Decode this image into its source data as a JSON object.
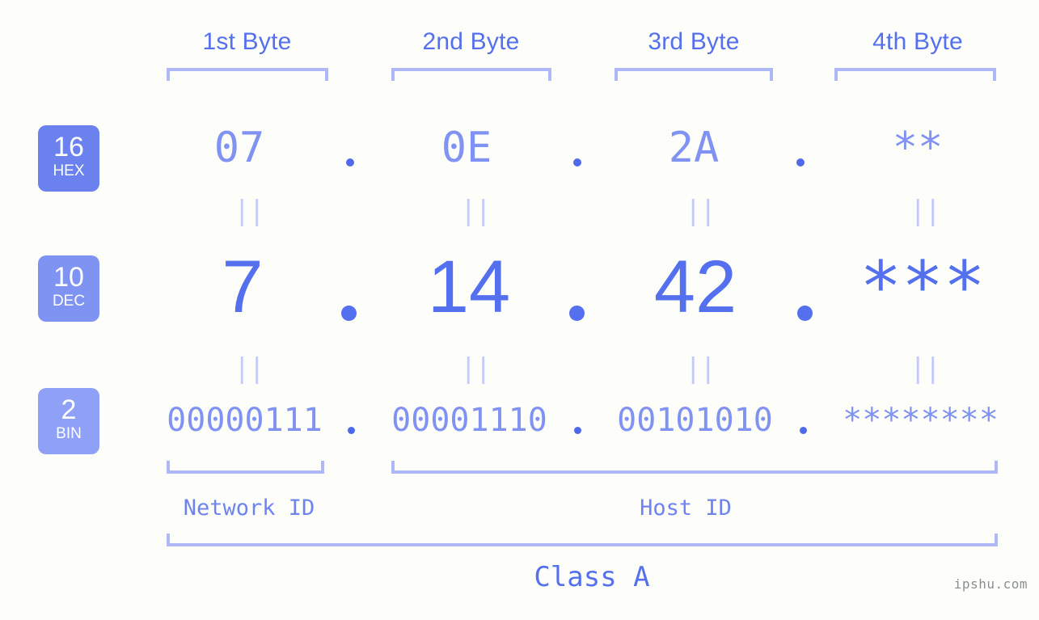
{
  "background_color": "#fdfef9",
  "accent_color": "#5570ee",
  "muted_accent_color": "#8193f2",
  "bracket_color": "#aeb8f7",
  "header": {
    "bytes": [
      {
        "label": "1st Byte"
      },
      {
        "label": "2nd Byte"
      },
      {
        "label": "3rd Byte"
      },
      {
        "label": "4th Byte"
      }
    ]
  },
  "radix_badges": [
    {
      "number": "16",
      "word": "HEX",
      "color": "#6a81ee"
    },
    {
      "number": "10",
      "word": "DEC",
      "color": "#7f93f2"
    },
    {
      "number": "2",
      "word": "BIN",
      "color": "#8ea1f6"
    }
  ],
  "rows": {
    "hex": {
      "radix_number": "16",
      "radix_word": "HEX",
      "values": [
        "07",
        "0E",
        "2A",
        "**"
      ],
      "separator": "."
    },
    "dec": {
      "radix_number": "10",
      "radix_word": "DEC",
      "values": [
        "7",
        "14",
        "42",
        "***"
      ],
      "separator": "."
    },
    "bin": {
      "radix_number": "2",
      "radix_word": "BIN",
      "values": [
        "00000111",
        "00001110",
        "00101010",
        "********"
      ],
      "separator": "."
    }
  },
  "equality_marks": {
    "glyph": "||",
    "count_per_row": 4
  },
  "footer": {
    "network_id_label": "Network ID",
    "host_id_label": "Host ID",
    "class_label": "Class A"
  },
  "watermark": "ipshu.com"
}
